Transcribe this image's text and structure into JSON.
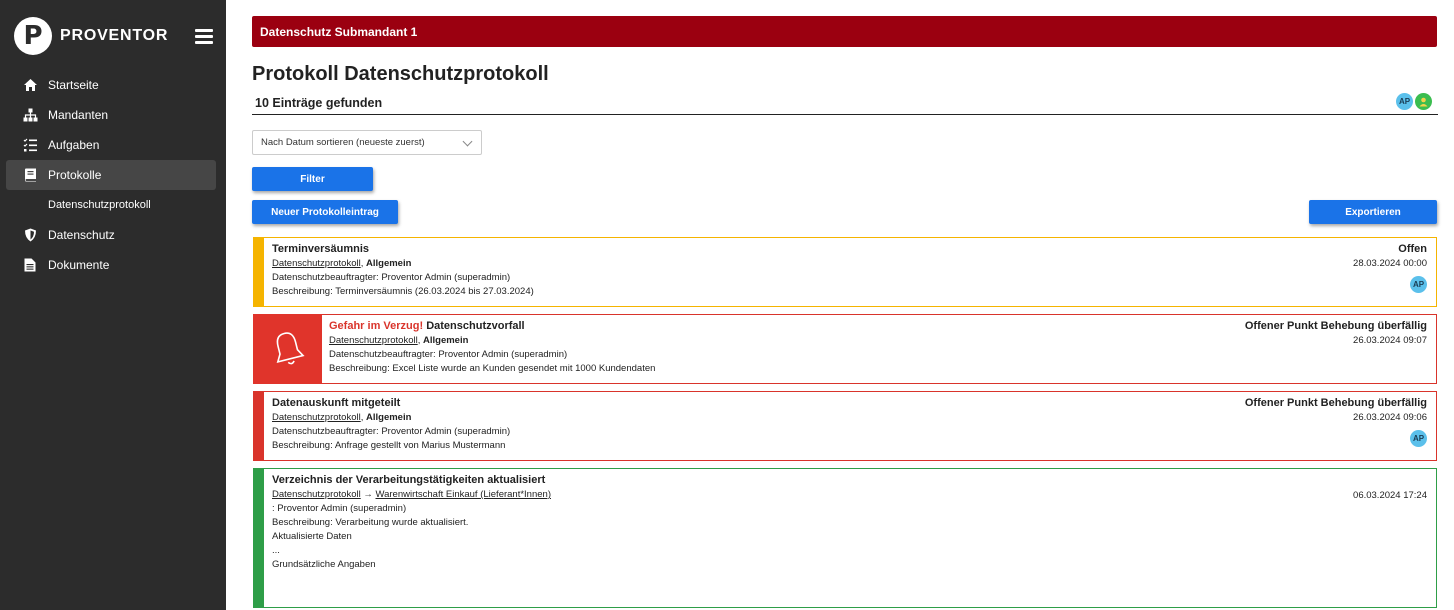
{
  "brand": {
    "logo_letter": "P",
    "name": "PROVENTOR"
  },
  "sidebar": {
    "items": [
      {
        "label": "Startseite",
        "icon": "home-icon"
      },
      {
        "label": "Mandanten",
        "icon": "hierarchy-icon"
      },
      {
        "label": "Aufgaben",
        "icon": "tasks-icon"
      },
      {
        "label": "Protokolle",
        "icon": "book-icon"
      },
      {
        "label": "Datenschutz",
        "icon": "shield-icon"
      },
      {
        "label": "Dokumente",
        "icon": "document-icon"
      }
    ],
    "sub_items": [
      {
        "label": "Datenschutzprotokoll"
      }
    ]
  },
  "banner": {
    "text": "Datenschutz Submandant 1",
    "color": "#9b0010"
  },
  "page": {
    "title": "Protokoll Datenschutzprotokoll",
    "count": "10 Einträge gefunden"
  },
  "header_avatars": [
    {
      "initials": "AP"
    },
    {
      "icon": "user-avatar-icon"
    }
  ],
  "sort": {
    "value": "Nach Datum sortieren (neueste zuerst)"
  },
  "buttons": {
    "filter": "Filter",
    "new_entry": "Neuer Protokolleintrag",
    "export": "Exportieren"
  },
  "entries": [
    {
      "title": "Terminversäumnis",
      "link": "Datenschutzprotokoll",
      "category": "Allgemein",
      "responsible": "Datenschutzbeauftragter: Proventor Admin (superadmin)",
      "description": "Beschreibung: Terminversäumnis (26.03.2024 bis 27.03.2024)",
      "status": "Offen",
      "date": "28.03.2024 00:00",
      "avatar": "AP",
      "color": "#f5b400"
    },
    {
      "urgent": "Gefahr im Verzug!",
      "title": "Datenschutzvorfall",
      "link": "Datenschutzprotokoll",
      "category": "Allgemein",
      "responsible": "Datenschutzbeauftragter: Proventor Admin (superadmin)",
      "description": "Beschreibung: Excel Liste wurde an Kunden gesendet mit 1000 Kundendaten",
      "status": "Offener Punkt Behebung überfällig",
      "date": "26.03.2024 09:07",
      "color": "#d9342b"
    },
    {
      "title": "Datenauskunft mitgeteilt",
      "link": "Datenschutzprotokoll",
      "category": "Allgemein",
      "responsible": "Datenschutzbeauftragter: Proventor Admin (superadmin)",
      "description": "Beschreibung: Anfrage gestellt von Marius Mustermann",
      "status": "Offener Punkt Behebung überfällig",
      "date": "26.03.2024 09:06",
      "avatar": "AP",
      "color": "#d9342b"
    },
    {
      "title": "Verzeichnis der Verarbeitungstätigkeiten aktualisiert",
      "link": "Datenschutzprotokoll",
      "arrow": "→",
      "link2": "Warenwirtschaft Einkauf (Lieferant*Innen)",
      "responsible": ": Proventor Admin (superadmin)",
      "description": "Beschreibung: Verarbeitung wurde aktualisiert.",
      "extra1": "Aktualisierte Daten",
      "extra2": "...",
      "extra3": "Grundsätzliche Angaben",
      "date": "06.03.2024 17:24",
      "color": "#2e9e48"
    }
  ]
}
